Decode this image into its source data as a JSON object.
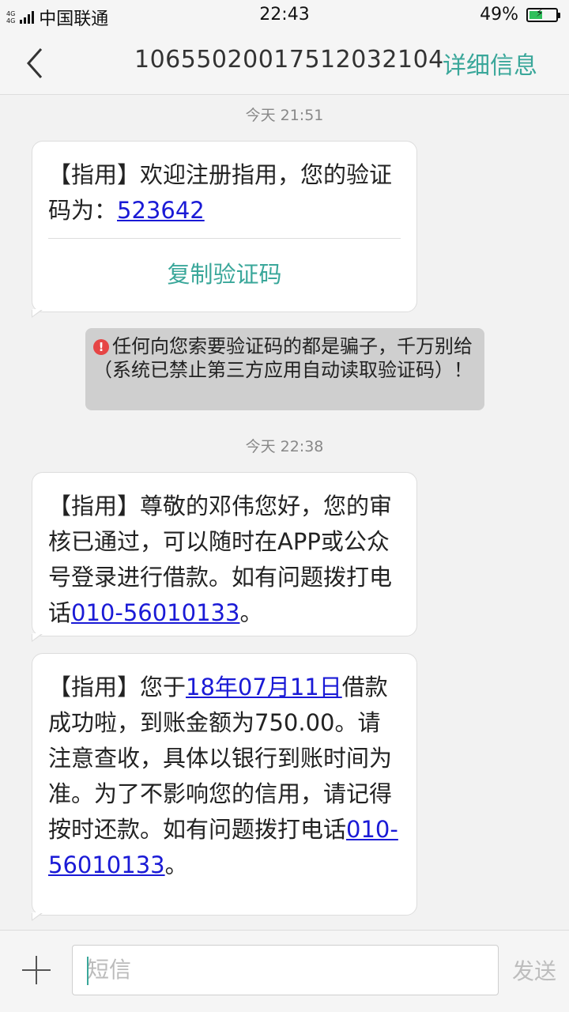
{
  "status_bar": {
    "network_tag_top": "4G",
    "network_tag_bottom": "4G",
    "carrier": "中国联通",
    "time": "22:43",
    "battery_percent": "49%",
    "battery_level": 0.49
  },
  "header": {
    "title": "10655020017512032104",
    "detail_label": "详细信息"
  },
  "messages": [
    {
      "time": "今天  21:51",
      "text_before": "【指用】欢迎注册指用，您的验证码为：",
      "link": "523642",
      "text_after": "",
      "copy_label": "复制验证码"
    },
    {
      "warning": "任何向您索要验证码的都是骗子，千万别给（系统已禁止第三方应用自动读取验证码）！"
    },
    {
      "time": "今天  22:38",
      "text_before": "【指用】尊敬的邓伟您好，您的审核已通过，可以随时在APP或公众号登录进行借款。如有问题拨打电话",
      "link": "010-56010133",
      "text_after": "。"
    },
    {
      "text_before": "【指用】您于",
      "link": "18年07月11日",
      "text_middle": "借款成功啦，到账金额为750.00。请注意查收，具体以银行到账时间为准。为了不影响您的信用，请记得按时还款。如有问题拨打电话",
      "link2": "010-56010133",
      "text_after": "。"
    }
  ],
  "input_bar": {
    "placeholder": "短信",
    "send_label": "发送"
  },
  "colors": {
    "accent": "#3aa79a",
    "link": "#1a1ad6",
    "warning_icon": "#e64545"
  }
}
